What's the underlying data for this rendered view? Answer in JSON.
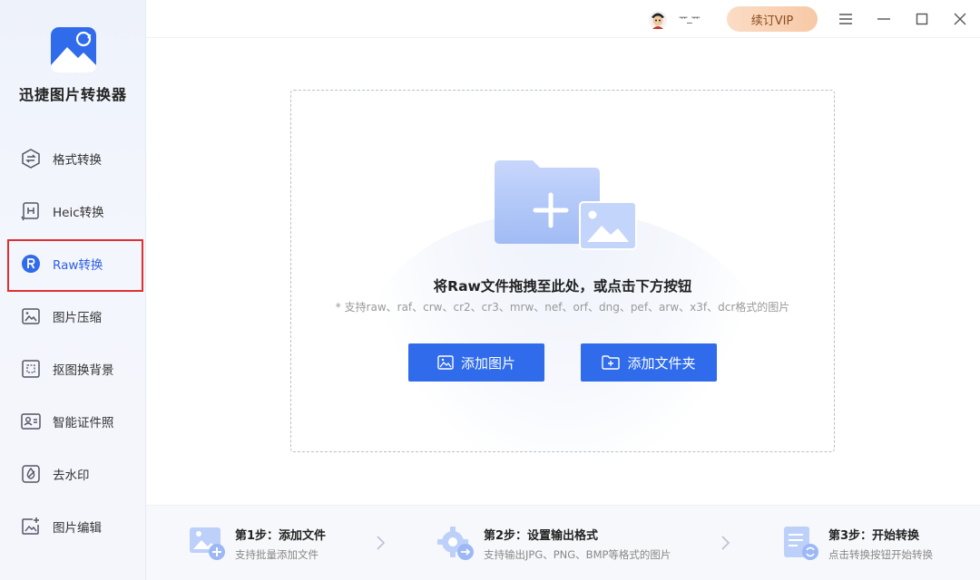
{
  "app": {
    "name": "迅捷图片转换器",
    "accent": "#2f6bea",
    "highlight_border": "#e12f2f"
  },
  "sidebar": {
    "items": [
      {
        "label": "格式转换",
        "icon": "format-convert-icon",
        "active": false
      },
      {
        "label": "Heic转换",
        "icon": "heic-icon",
        "active": false
      },
      {
        "label": "Raw转换",
        "icon": "raw-icon",
        "active": true
      },
      {
        "label": "图片压缩",
        "icon": "image-compress-icon",
        "active": false
      },
      {
        "label": "抠图换背景",
        "icon": "cutout-icon",
        "active": false
      },
      {
        "label": "智能证件照",
        "icon": "id-photo-icon",
        "active": false
      },
      {
        "label": "去水印",
        "icon": "watermark-remove-icon",
        "active": false
      },
      {
        "label": "图片编辑",
        "icon": "image-edit-icon",
        "active": false
      }
    ]
  },
  "topbar": {
    "username": "ᅲ_ᅲ",
    "vip_label": "续订VIP",
    "vip_color": "#f7c9a6"
  },
  "dropzone": {
    "title": "将Raw文件拖拽至此处，或点击下方按钮",
    "subtitle": "* 支持raw、raf、crw、cr2、cr3、mrw、nef、orf、dng、pef、arw、x3f、dcr格式的图片",
    "add_image_label": "添加图片",
    "add_folder_label": "添加文件夹"
  },
  "steps": [
    {
      "title": "第1步：添加文件",
      "desc": "支持批量添加文件"
    },
    {
      "title": "第2步：设置输出格式",
      "desc": "支持输出JPG、PNG、BMP等格式的图片"
    },
    {
      "title": "第3步：开始转换",
      "desc": "点击转换按钮开始转换"
    }
  ]
}
